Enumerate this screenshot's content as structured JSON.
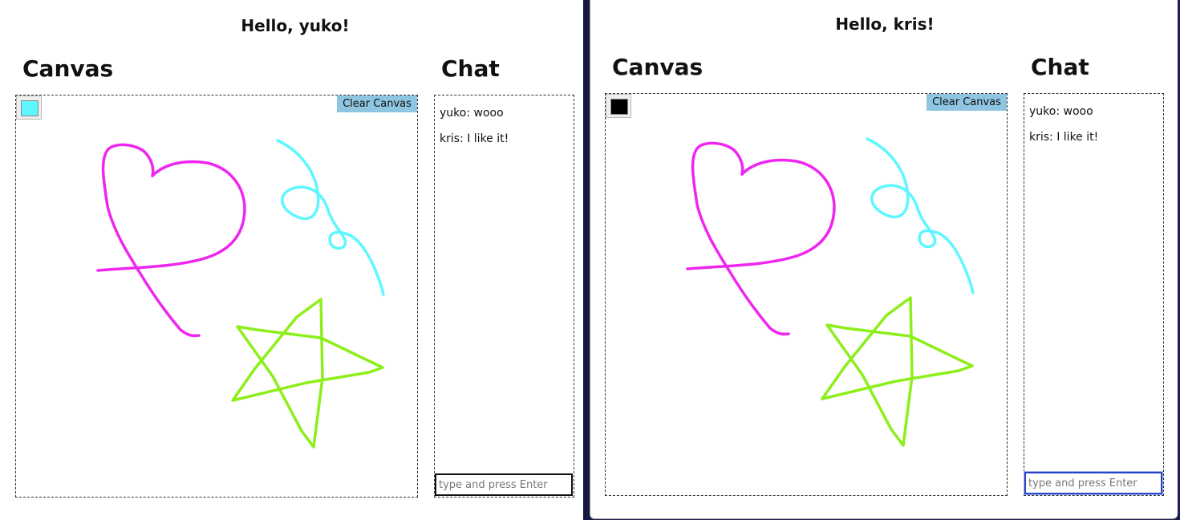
{
  "colors": {
    "magenta": "#ef26ef",
    "cyan": "#5ef7ff",
    "lime": "#8def1a",
    "clear_button_bg": "#8ec5e0"
  },
  "windows": [
    {
      "greeting": "Hello, yuko!",
      "canvas_title": "Canvas",
      "chat_title": "Chat",
      "selected_color": "#5ef7ff",
      "clear_button_label": "Clear Canvas",
      "chat_messages": [
        "yuko: wooo",
        "kris: I like it!"
      ],
      "chat_input_placeholder": "type and press Enter",
      "chat_input_value": ""
    },
    {
      "greeting": "Hello, kris!",
      "canvas_title": "Canvas",
      "chat_title": "Chat",
      "selected_color": "#000000",
      "clear_button_label": "Clear Canvas",
      "chat_messages": [
        "yuko: wooo",
        "kris: I like it!"
      ],
      "chat_input_placeholder": "type and press Enter",
      "chat_input_value": ""
    }
  ]
}
